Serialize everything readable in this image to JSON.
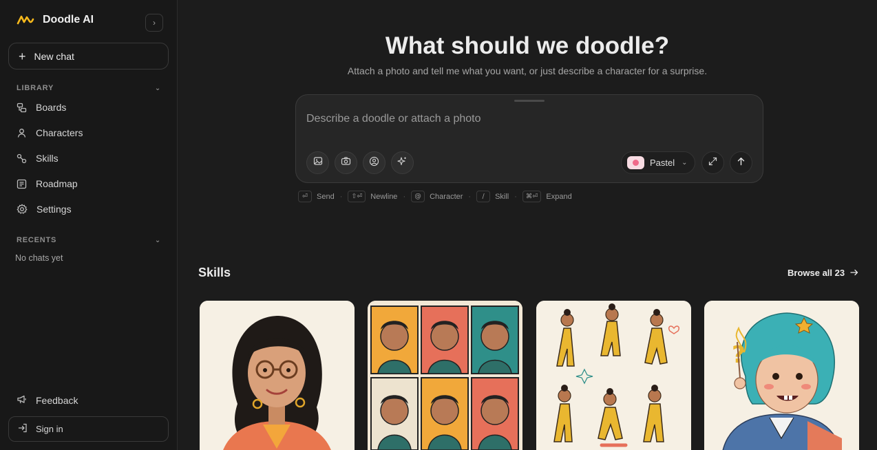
{
  "sidebar": {
    "brand": "Doodle AI",
    "new_chat": "New chat",
    "library_heading": "LIBRARY",
    "items": [
      {
        "label": "Boards",
        "icon": "boards-icon"
      },
      {
        "label": "Characters",
        "icon": "user-icon"
      },
      {
        "label": "Skills",
        "icon": "skills-icon"
      },
      {
        "label": "Roadmap",
        "icon": "roadmap-icon"
      },
      {
        "label": "Settings",
        "icon": "gear-icon"
      }
    ],
    "recents_heading": "RECENTS",
    "recents_empty": "No chats yet",
    "feedback": "Feedback",
    "sign_in": "Sign in"
  },
  "hero": {
    "title": "What should we doodle?",
    "subtitle": "Attach a photo and tell me what you want, or just describe a character for a surprise."
  },
  "composer": {
    "placeholder": "Describe a doodle or attach a photo",
    "style_label": "Pastel",
    "style_color": "#f06a8a"
  },
  "hints": [
    {
      "key": "⏎",
      "label": "Send"
    },
    {
      "key": "⇧⏎",
      "label": "Newline"
    },
    {
      "key": "@",
      "label": "Character"
    },
    {
      "key": "/",
      "label": "Skill"
    },
    {
      "key": "⌘⏎",
      "label": "Expand"
    }
  ],
  "skills": {
    "title": "Skills",
    "browse": "Browse all 23"
  },
  "colors": {
    "accent": "#f5b81c",
    "background": "#1c1c1c",
    "sidebar": "#181818"
  }
}
